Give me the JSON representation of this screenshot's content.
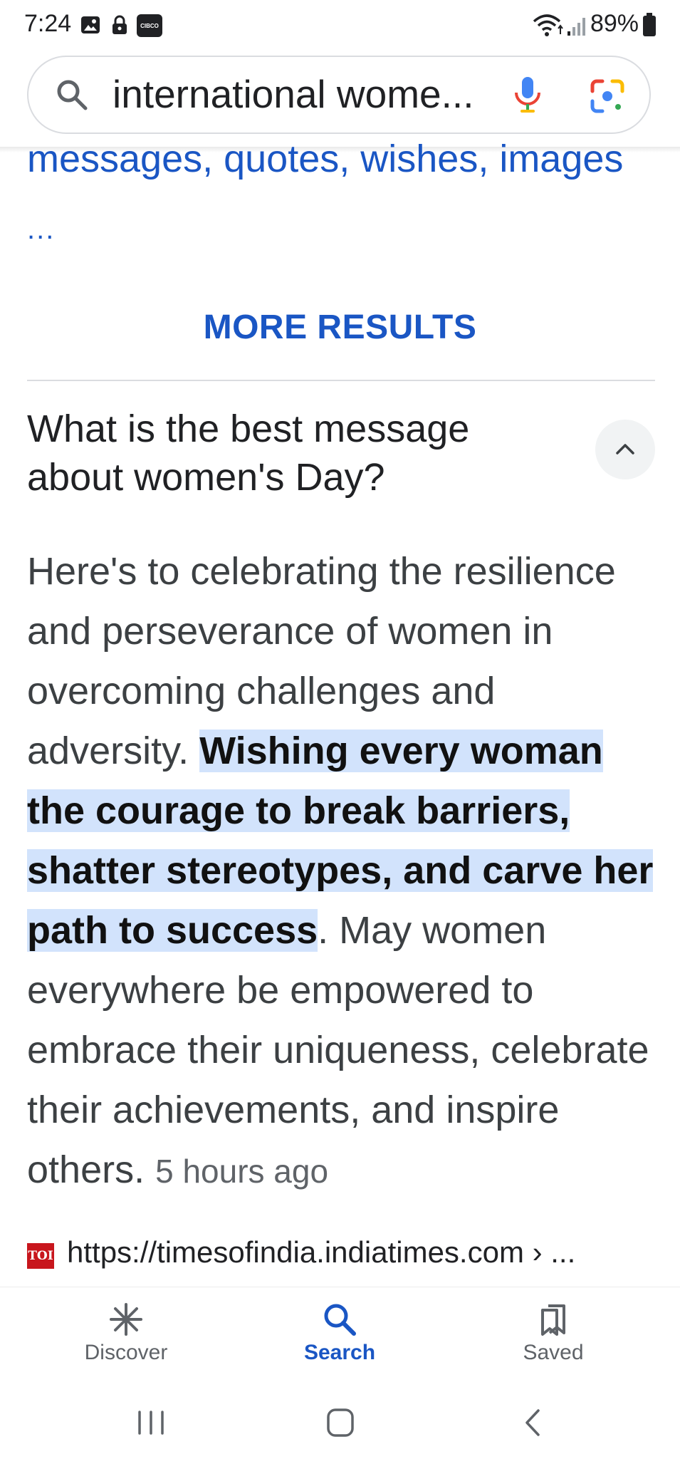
{
  "status_bar": {
    "time": "7:24",
    "carrier_badge": "CIBCO",
    "battery": "89%"
  },
  "search": {
    "query": "international wome..."
  },
  "previous_result": {
    "title_tail": "messages, quotes, wishes, images",
    "ellipsis": "..."
  },
  "more_results_label": "MORE RESULTS",
  "faq": {
    "question": "What is the best message about women's Day?",
    "answer_before": "Here's to celebrating the resilience and perseverance of women in overcoming challenges and adversity. ",
    "answer_highlight": "Wishing every woman the courage to break barriers, shatter stereotypes, and carve her path to success",
    "answer_after": ". May women everywhere be empowered to embrace their uniqueness, celebrate their achievements, and inspire others. ",
    "timestamp": "5 hours ago",
    "source_logo": "TOI",
    "source_url": "https://timesofindia.indiatimes.com › ..."
  },
  "bottom_nav": {
    "discover": "Discover",
    "search": "Search",
    "saved": "Saved"
  },
  "colors": {
    "link_blue": "#1a56c4",
    "highlight": "#d2e3fc",
    "toi_red": "#c8161d"
  }
}
